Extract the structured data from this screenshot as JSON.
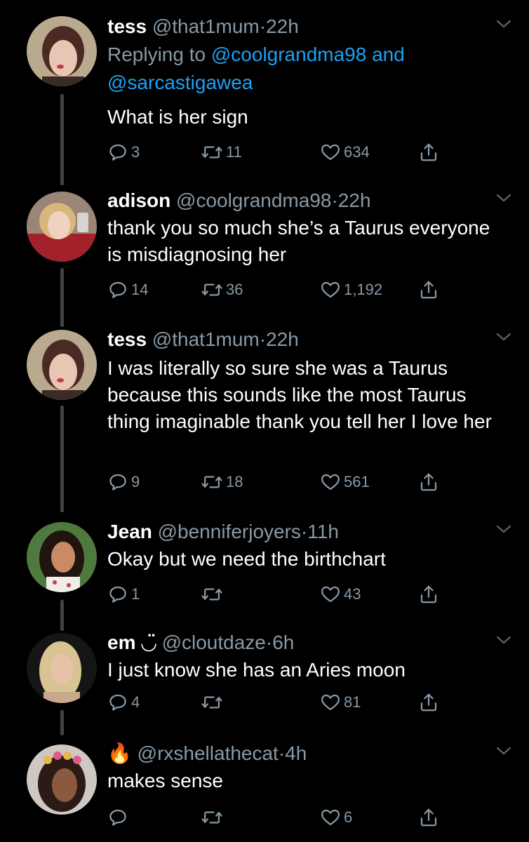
{
  "colors": {
    "background": "#000000",
    "text": "#ffffff",
    "secondary": "#8899a6",
    "link": "#1da1f2",
    "thread_line": "#3d4349"
  },
  "tweets": [
    {
      "name": "tess",
      "handle": "@that1mum",
      "time": "22h",
      "reply_prefix": "Replying to ",
      "reply_mention_1": "@coolgrandma98",
      "reply_and": " and",
      "reply_mention_2": "@sarcastigawea",
      "text": "What is her sign",
      "replies": "3",
      "retweets": "11",
      "likes": "634"
    },
    {
      "name": "adison",
      "handle": "@coolgrandma98",
      "time": "22h",
      "text": "thank you so much she’s a Taurus everyone is misdiagnosing her",
      "replies": "14",
      "retweets": "36",
      "likes": "1,192"
    },
    {
      "name": "tess",
      "handle": "@that1mum",
      "time": "22h",
      "text": "I was literally so sure she was a Taurus because this sounds like the most Taurus thing imaginable thank you tell her I love her",
      "replies": "9",
      "retweets": "18",
      "likes": "561"
    },
    {
      "name": "Jean",
      "handle": "@benniferjoyers",
      "time": "11h",
      "text": "Okay but we need the birthchart",
      "replies": "1",
      "retweets": "",
      "likes": "43"
    },
    {
      "name": "em ◡̈",
      "handle": "@cloutdaze",
      "time": "6h",
      "text": "I just know she has an Aries moon",
      "replies": "4",
      "retweets": "",
      "likes": "81"
    },
    {
      "name": "🔥",
      "handle": "@rxshellathecat",
      "time": "4h",
      "text": "makes sense",
      "replies": "",
      "retweets": "",
      "likes": "6"
    }
  ],
  "separator": "·",
  "icons": {
    "reply": "reply-icon",
    "retweet": "retweet-icon",
    "like": "heart-icon",
    "share": "share-icon",
    "menu": "chevron-down-icon"
  }
}
